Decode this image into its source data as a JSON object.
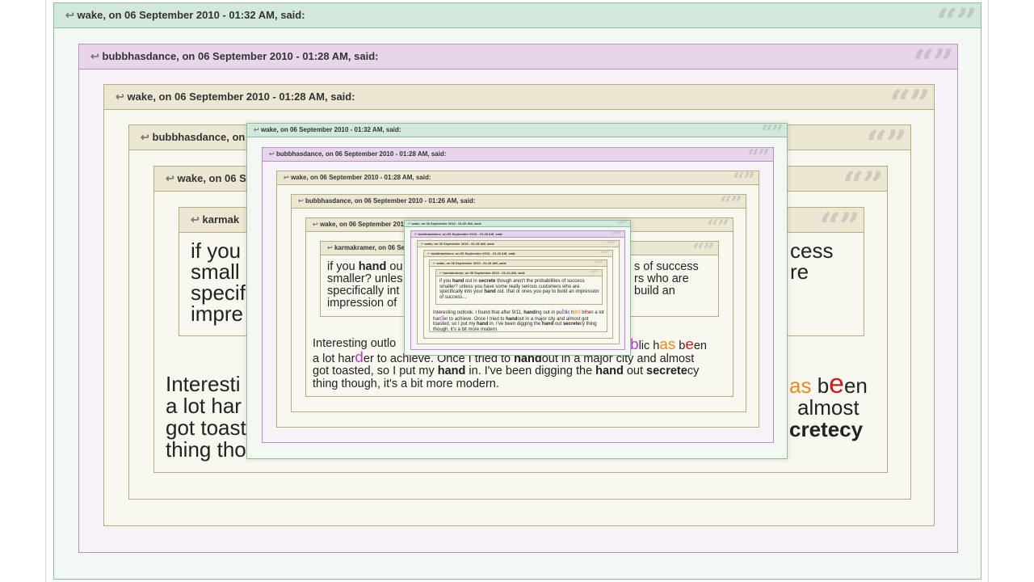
{
  "quote_headers": {
    "wake_0132": "wake, on 06 September 2010 - 01:32 AM, said:",
    "bubb_0128": "bubbhasdance, on 06 September 2010 - 01:28 AM, said:",
    "wake_0128": "wake, on 06 September 2010 - 01:28 AM, said:",
    "bubb_0126": "bubbhasdance, on 06 September 2010 - 01:26 AM, said:",
    "wake_0126": "wake, on 06 September 2010 - 01:26 AM, said:",
    "karmak_clip": "karmak",
    "karmakramer_clip": "karmakramer, on 06 Sep",
    "bubb_clip": "bubbhasdance, on",
    "wake_clip": "wake, on 06 S",
    "wake_0126_clip": "wake, on 06 September 2010 -",
    "karmakramer_0124": "karmakramer, on 06 September 2010 - 01:24 AM, said:"
  },
  "quote_icon": "reply-arrow-icon",
  "quote_marks": "“”",
  "colors": {
    "green_border": "#8dbf9c",
    "purple_border": "#b493c2",
    "tan_border": "#b5ad7f",
    "magenta": "#c23bd1",
    "orange": "#e98a1e",
    "red": "#c81f26"
  },
  "large_view": {
    "inner_quote_lines": [
      "if you",
      "small",
      "specif",
      "impre"
    ],
    "right_clip_lines": [
      "cess",
      "re"
    ],
    "reply_lines": [
      "Interesti",
      "a lot har",
      "got toast",
      "thing tho"
    ],
    "reply_right_1": "as",
    "reply_right_1b": " b",
    "reply_right_1c": "e",
    "reply_right_1d": "en",
    "reply_right_2": "almost",
    "reply_right_3": "cretecy"
  },
  "mid_view": {
    "inner_quote_line1_a": "if you ",
    "inner_quote_line1_b": "hand",
    "inner_quote_line1_c": " ou",
    "inner_quote_line1_right": "s of success",
    "inner_quote_line2": "smaller? unles",
    "inner_quote_line2_right": "rs who are",
    "inner_quote_line3": "specifically int",
    "inner_quote_line3_right": "build an",
    "inner_quote_line4": "impression of",
    "reply_line1_left": "Interesting outlo",
    "reply_line1_right_a": "u",
    "reply_line1_right_b": "b",
    "reply_line1_right_c": "lic h",
    "reply_line1_right_d": "as",
    "reply_line1_right_e": " b",
    "reply_line1_right_f": "e",
    "reply_line1_right_g": "en",
    "reply_line2_a": "a lot har",
    "reply_line2_b": "d",
    "reply_line2_c": "er to ac",
    "reply_line2_hidden": "hieve. Once I tried to ",
    "reply_line2_hand": "hand",
    "reply_line2_d": "out in a major city and almost",
    "reply_line3_a": "got toasted, so I put my ",
    "reply_line3_b": "hand",
    "reply_line3_c": " in. I've been digging the ",
    "reply_line3_d": "hand",
    "reply_line3_e": " out ",
    "reply_line3_f": "secrete",
    "reply_line3_g": "cy",
    "reply_line4": "thing though, it's a bit more modern."
  },
  "small_view": {
    "quote_a": "if you ",
    "quote_hand": "hand",
    "quote_b": " out in ",
    "quote_secrete": "secrete",
    "quote_c": " though aren't the probabilities of success smaller? unless you have some really serious customers who are specifically into your ",
    "quote_hand2": "hand",
    "quote_d": " out. that or ones you pay to build an impression of success...",
    "reply_a": "Interesting outlook. I found that after 9/11, ",
    "reply_handing": "hand",
    "reply_b": "ing out in pu",
    "reply_b2": "b",
    "reply_b3": "lic h",
    "reply_as": "as",
    "reply_b4": " b",
    "reply_e": "e",
    "reply_en": "en a lot har",
    "reply_d": "d",
    "reply_er": "er to achieve. Once I tried to ",
    "reply_handout": "hand",
    "reply_f": "out in a major city and almost got toasted, so I put my ",
    "reply_hand": "hand",
    "reply_g": " in. I've been digging the ",
    "reply_hand2": "hand",
    "reply_h": " out ",
    "reply_secrete": "secrete",
    "reply_i": "cy thing though, it's a bit more modern."
  }
}
